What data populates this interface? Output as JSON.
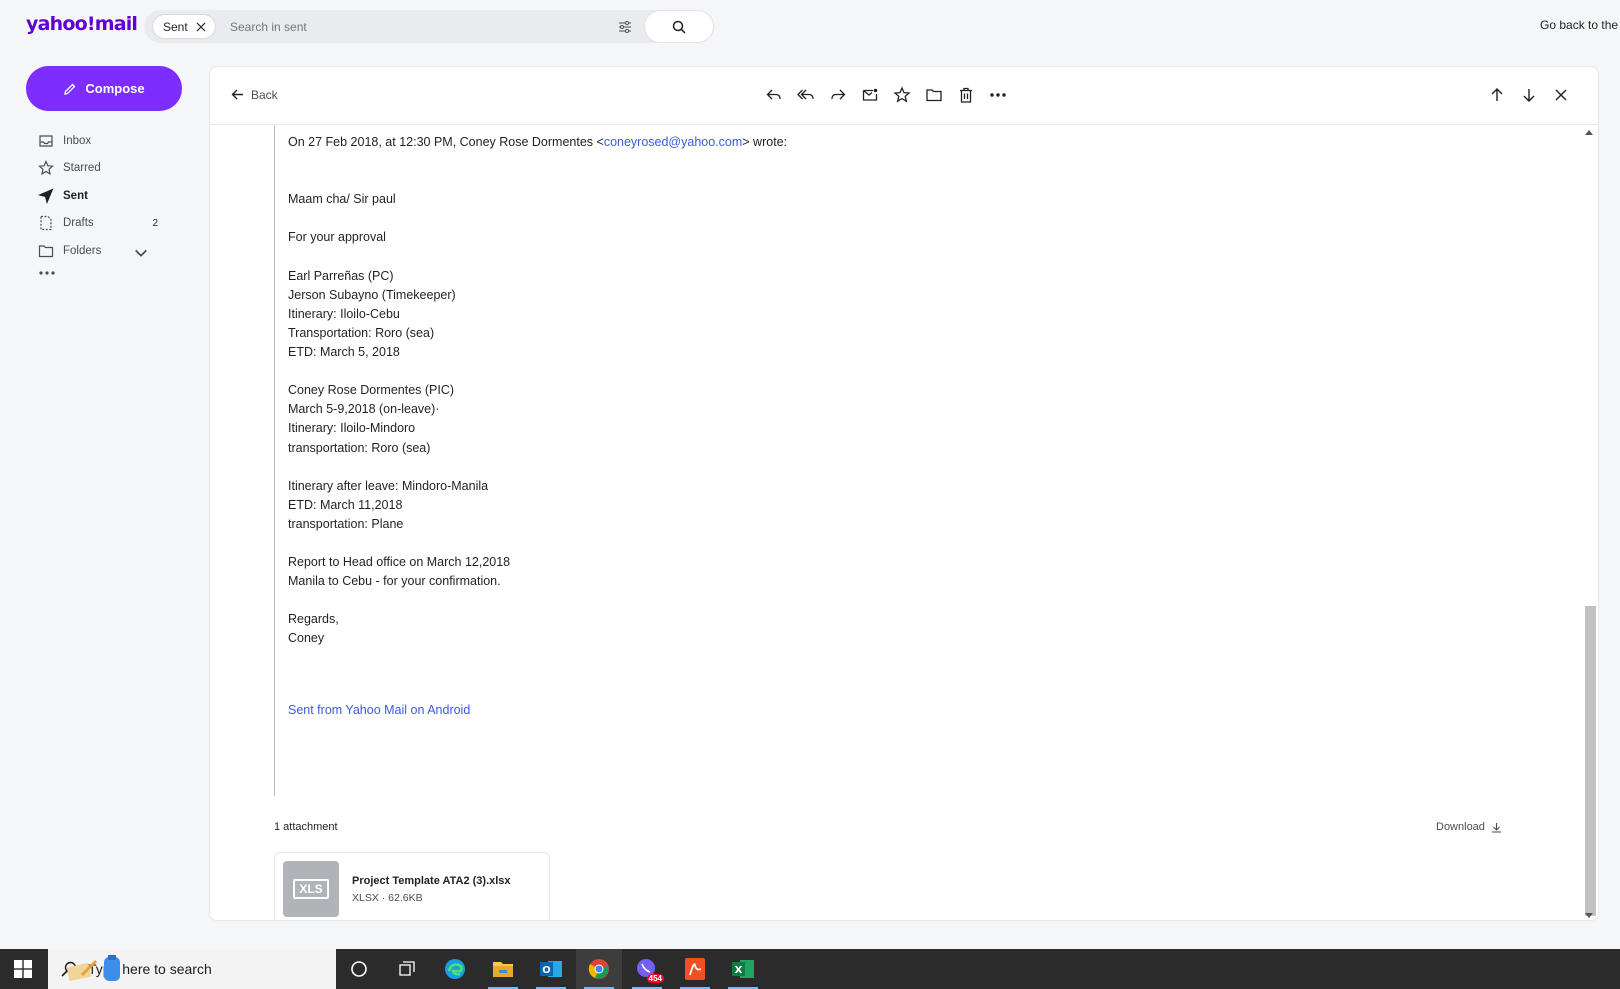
{
  "topbar": {
    "logo": "yahoo!mail",
    "chip_label": "Sent",
    "search_placeholder": "Search in sent",
    "go_back": "Go back to the o"
  },
  "sidebar": {
    "compose": "Compose",
    "items": [
      {
        "label": "Inbox",
        "icon": "inbox-icon"
      },
      {
        "label": "Starred",
        "icon": "star-icon"
      },
      {
        "label": "Sent",
        "icon": "send-icon",
        "active": true
      },
      {
        "label": "Drafts",
        "icon": "drafts-icon",
        "count": "2"
      },
      {
        "label": "Folders",
        "icon": "folder-icon"
      }
    ]
  },
  "toolbar": {
    "back": "Back"
  },
  "email": {
    "quote_header_prefix": "On 27 Feb 2018, at 12:30 PM, Coney Rose Dormentes <",
    "quote_email": "coneyrosed@yahoo.com",
    "quote_header_suffix": "> wrote:",
    "lines": {
      "greeting": "Maam cha/ Sir paul",
      "approval": "For your approval",
      "b1_1": "Earl Parreñas (PC)",
      "b1_2": "Jerson Subayno (Timekeeper)",
      "b1_3": "Itinerary: Iloilo-Cebu",
      "b1_4": "Transportation: Roro (sea)",
      "b1_5": "ETD: March 5, 2018",
      "b2_1": "Coney Rose Dormentes (PIC)",
      "b2_2": "March 5-9,2018 (on-leave)·",
      "b2_3": "Itinerary: Iloilo-Mindoro",
      "b2_4": "transportation: Roro (sea)",
      "b3_1": "Itinerary after leave: Mindoro-Manila",
      "b3_2": "ETD: March 11,2018",
      "b3_3": "transportation: Plane",
      "b4_1": "Report to Head office on March 12,2018",
      "b4_2": "Manila to Cebu - for your confirmation.",
      "regards": "Regards,",
      "name": "Coney"
    },
    "signature_link": "Sent from Yahoo Mail on Android"
  },
  "attachments": {
    "title": "1 attachment",
    "download": "Download",
    "file_name": "Project Template ATA2 (3).xlsx",
    "file_meta": "XLSX · 62.6KB",
    "thumb_label": "XLS"
  },
  "taskbar": {
    "search_placeholder": "Type here to search",
    "viber_badge": "454"
  },
  "colors": {
    "brand": "#5f01d1",
    "compose": "#7d2eff",
    "link": "#3c5ae6"
  }
}
